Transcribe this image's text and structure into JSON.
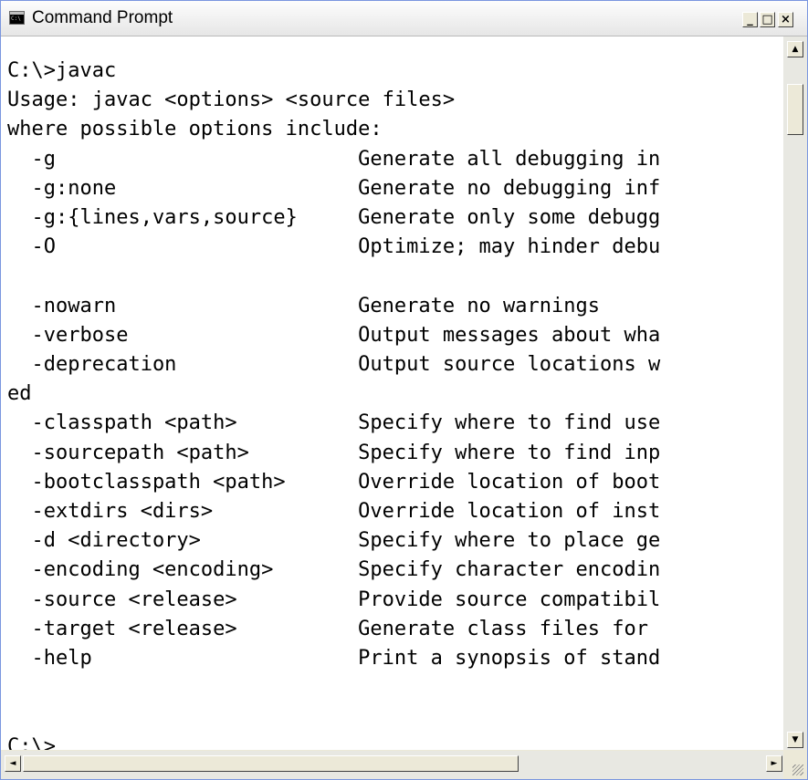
{
  "window": {
    "title": "Command Prompt",
    "icon": "console-icon",
    "icon_text": "C:\\",
    "controls": {
      "minimize": "_",
      "maximize": "□",
      "close": "×"
    }
  },
  "console": {
    "text": "C:\\>javac\nUsage: javac <options> <source files>\nwhere possible options include:\n  -g                         Generate all debugging in\n  -g:none                    Generate no debugging inf\n  -g:{lines,vars,source}     Generate only some debugg\n  -O                         Optimize; may hinder debu\n\n  -nowarn                    Generate no warnings\n  -verbose                   Output messages about wha\n  -deprecation               Output source locations w\ned\n  -classpath <path>          Specify where to find use\n  -sourcepath <path>         Specify where to find inp\n  -bootclasspath <path>      Override location of boot\n  -extdirs <dirs>            Override location of inst\n  -d <directory>             Specify where to place ge\n  -encoding <encoding>       Specify character encodin\n  -source <release>          Provide source compatibil\n  -target <release>          Generate class files for \n  -help                      Print a synopsis of stand\n\n\nC:\\>"
  },
  "scrollbars": {
    "up_arrow": "▲",
    "down_arrow": "▼",
    "left_arrow": "◄",
    "right_arrow": "►"
  }
}
